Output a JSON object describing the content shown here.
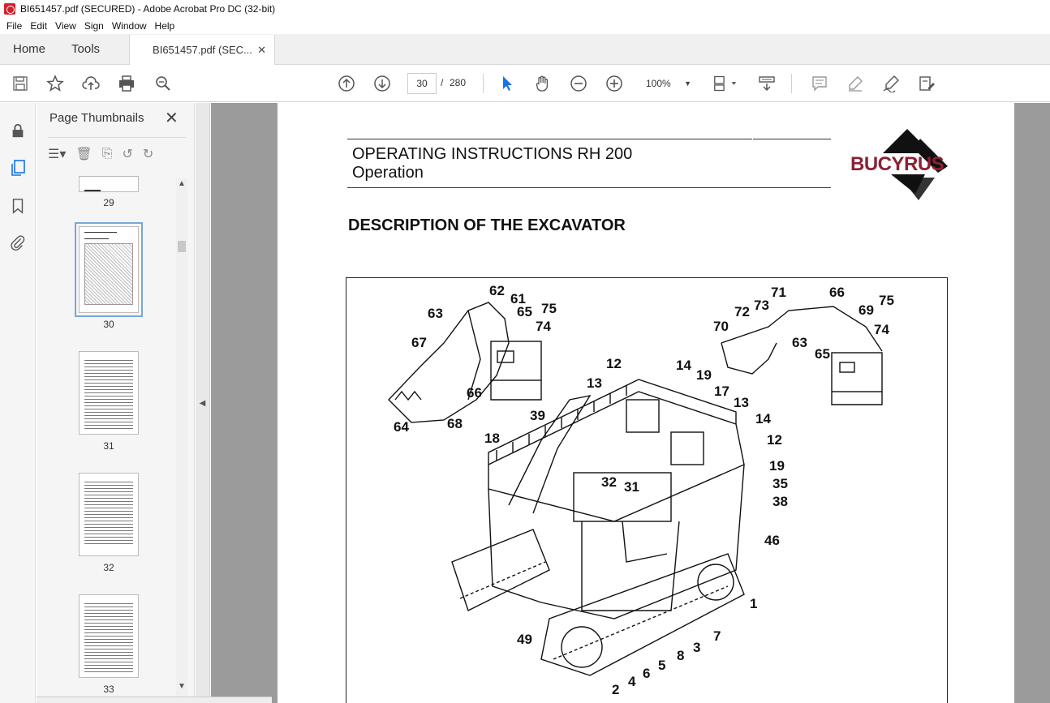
{
  "window": {
    "title": "BI651457.pdf (SECURED) - Adobe Acrobat Pro DC (32-bit)"
  },
  "menu": [
    "File",
    "Edit",
    "View",
    "Sign",
    "Window",
    "Help"
  ],
  "tabs": {
    "home": "Home",
    "tools": "Tools",
    "document": "BI651457.pdf (SEC...",
    "close": "✕"
  },
  "toolbar": {
    "page_current": "30",
    "page_separator": "/",
    "page_total": "280",
    "zoom": "100%"
  },
  "panel": {
    "title": "Page Thumbnails",
    "close": "✕",
    "thumbnails": [
      {
        "label": "29"
      },
      {
        "label": "30"
      },
      {
        "label": "31"
      },
      {
        "label": "32"
      },
      {
        "label": "33"
      }
    ]
  },
  "document": {
    "header_title": "OPERATING INSTRUCTIONS RH 200",
    "header_subtitle": "Operation",
    "brand": "BUCYRUS",
    "section_heading": "DESCRIPTION OF THE EXCAVATOR",
    "callouts": [
      "62",
      "61",
      "63",
      "65",
      "75",
      "74",
      "67",
      "66",
      "64",
      "68",
      "71",
      "66",
      "73",
      "72",
      "69",
      "75",
      "70",
      "74",
      "63",
      "65",
      "12",
      "14",
      "13",
      "19",
      "17",
      "13",
      "39",
      "14",
      "18",
      "12",
      "19",
      "32",
      "31",
      "35",
      "38",
      "46",
      "1",
      "49",
      "7",
      "3",
      "8",
      "5",
      "6",
      "4",
      "2"
    ]
  },
  "colors": {
    "brand": "#8b2135",
    "accent": "#1473e6",
    "viewer_bg": "#9b9b9b"
  }
}
